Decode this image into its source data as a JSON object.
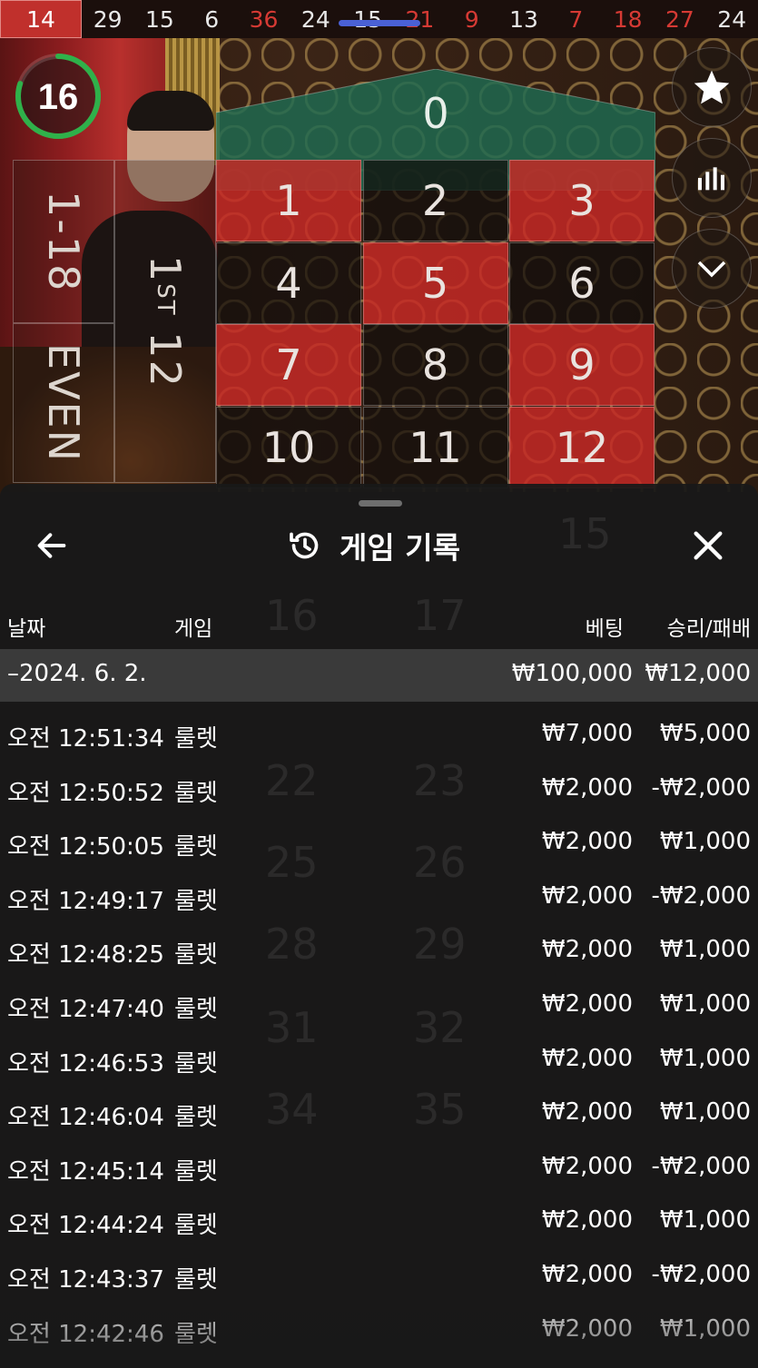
{
  "results_strip": {
    "items": [
      {
        "value": "14",
        "color": "red",
        "current": true
      },
      {
        "value": "29",
        "color": "black"
      },
      {
        "value": "15",
        "color": "black"
      },
      {
        "value": "6",
        "color": "black"
      },
      {
        "value": "36",
        "color": "red"
      },
      {
        "value": "24",
        "color": "black"
      },
      {
        "value": "15",
        "color": "black"
      },
      {
        "value": "21",
        "color": "red"
      },
      {
        "value": "9",
        "color": "red"
      },
      {
        "value": "13",
        "color": "black"
      },
      {
        "value": "7",
        "color": "red"
      },
      {
        "value": "18",
        "color": "red"
      },
      {
        "value": "27",
        "color": "red"
      },
      {
        "value": "24",
        "color": "black"
      }
    ]
  },
  "timer": {
    "value": "16",
    "progress": 0.8
  },
  "side_buttons": [
    "star-icon",
    "statistics-icon",
    "chevron-down-icon"
  ],
  "board": {
    "zero": "0",
    "numbers": [
      {
        "n": "1",
        "color": "red"
      },
      {
        "n": "2",
        "color": "black"
      },
      {
        "n": "3",
        "color": "red"
      },
      {
        "n": "4",
        "color": "black"
      },
      {
        "n": "5",
        "color": "red"
      },
      {
        "n": "6",
        "color": "black"
      },
      {
        "n": "7",
        "color": "red"
      },
      {
        "n": "8",
        "color": "black"
      },
      {
        "n": "9",
        "color": "red"
      },
      {
        "n": "10",
        "color": "black"
      },
      {
        "n": "11",
        "color": "black"
      },
      {
        "n": "12",
        "color": "red"
      }
    ],
    "low_label": "1-18",
    "even_label": "EVEN",
    "dozen_label_num": "1",
    "dozen_label_sup": "ST",
    "dozen_label_rest": "12"
  },
  "history": {
    "title": "게임 기록",
    "columns": {
      "date": "날짜",
      "game": "게임",
      "bet": "베팅",
      "win_loss": "승리/패배"
    },
    "date_group": {
      "date": "–2024. 6. 2.",
      "bet": "₩100,000",
      "win_loss": "₩12,000"
    },
    "rows": [
      {
        "time": "오전 12:51:34",
        "game": "룰렛",
        "bet": "₩7,000",
        "win_loss": "₩5,000"
      },
      {
        "time": "오전 12:50:52",
        "game": "룰렛",
        "bet": "₩2,000",
        "win_loss": "-₩2,000"
      },
      {
        "time": "오전 12:50:05",
        "game": "룰렛",
        "bet": "₩2,000",
        "win_loss": "₩1,000"
      },
      {
        "time": "오전 12:49:17",
        "game": "룰렛",
        "bet": "₩2,000",
        "win_loss": "-₩2,000"
      },
      {
        "time": "오전 12:48:25",
        "game": "룰렛",
        "bet": "₩2,000",
        "win_loss": "₩1,000"
      },
      {
        "time": "오전 12:47:40",
        "game": "룰렛",
        "bet": "₩2,000",
        "win_loss": "₩1,000"
      },
      {
        "time": "오전 12:46:53",
        "game": "룰렛",
        "bet": "₩2,000",
        "win_loss": "₩1,000"
      },
      {
        "time": "오전 12:46:04",
        "game": "룰렛",
        "bet": "₩2,000",
        "win_loss": "₩1,000"
      },
      {
        "time": "오전 12:45:14",
        "game": "룰렛",
        "bet": "₩2,000",
        "win_loss": "-₩2,000"
      },
      {
        "time": "오전 12:44:24",
        "game": "룰렛",
        "bet": "₩2,000",
        "win_loss": "₩1,000"
      },
      {
        "time": "오전 12:43:37",
        "game": "룰렛",
        "bet": "₩2,000",
        "win_loss": "-₩2,000"
      },
      {
        "time": "오전 12:42:46",
        "game": "룰렛",
        "bet": "₩2,000",
        "win_loss": "₩1,000"
      }
    ]
  },
  "colors": {
    "red": "#c92826",
    "black": "#100c0b",
    "zero_green": "#1f6b52",
    "timer_green": "#2fb14a",
    "strip_slider": "#4a61d6"
  }
}
